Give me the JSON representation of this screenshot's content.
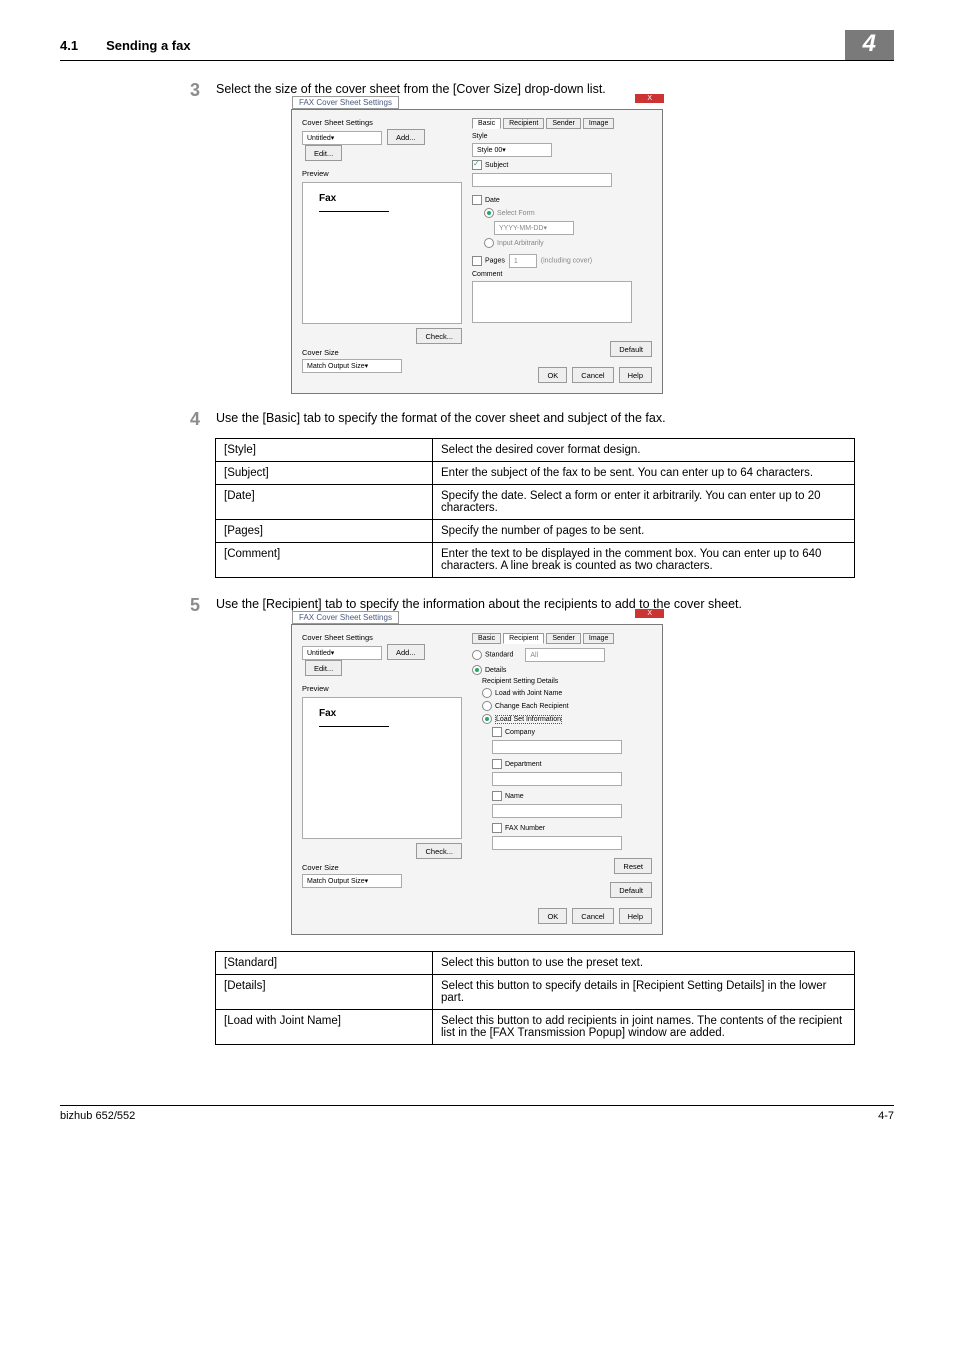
{
  "header": {
    "sec": "4.1",
    "title": "Sending a fax",
    "chapter": "4"
  },
  "steps": {
    "s3": {
      "num": "3",
      "txt": "Select the size of the cover sheet from the [Cover Size] drop-down list."
    },
    "s4": {
      "num": "4",
      "txt": "Use the [Basic] tab to specify the format of the cover sheet and subject of the fax."
    },
    "s5": {
      "num": "5",
      "txt": "Use the [Recipient] tab to specify the information about the recipients to add to the cover sheet."
    }
  },
  "dlg": {
    "title": "FAX Cover Sheet Settings",
    "coverSheetSettings": "Cover Sheet Settings",
    "untitled": "Untitled",
    "add": "Add...",
    "edit": "Edit...",
    "preview": "Preview",
    "fax": "Fax",
    "check": "Check...",
    "coverSize": "Cover Size",
    "match": "Match Output Size",
    "ok": "OK",
    "cancel": "Cancel",
    "help": "Help",
    "default": "Default",
    "tabs": {
      "basic": "Basic",
      "recipient": "Recipient",
      "sender": "Sender",
      "image": "Image"
    },
    "basic": {
      "style": "Style",
      "styleSel": "Style 00",
      "subject": "Subject",
      "date": "Date",
      "selectForm": "Select Form",
      "dateFmt": "YYYY-MM-DD",
      "inputArb": "Input Arbitrarily",
      "pages": "Pages",
      "pagesVal": "1",
      "inclCover": "(including cover)",
      "comment": "Comment"
    },
    "recipient": {
      "standard": "Standard",
      "all": "All",
      "details": "Details",
      "rsd": "Recipient Setting Details",
      "loadJoint": "Load with Joint Name",
      "changeEach": "Change Each Recipient",
      "loadSet": "Load Set Information",
      "company": "Company",
      "department": "Department",
      "name": "Name",
      "faxnum": "FAX Number",
      "reset": "Reset"
    }
  },
  "table4": [
    {
      "k": "[Style]",
      "v": "Select the desired cover format design."
    },
    {
      "k": "[Subject]",
      "v": "Enter the subject of the fax to be sent. You can enter up to 64 characters."
    },
    {
      "k": "[Date]",
      "v": "Specify the date. Select a form or enter it arbitrarily. You can enter up to 20 characters."
    },
    {
      "k": "[Pages]",
      "v": "Specify the number of pages to be sent."
    },
    {
      "k": "[Comment]",
      "v": "Enter the text to be displayed in the comment box. You can enter up to 640 characters. A line break is counted as two characters."
    }
  ],
  "table5": [
    {
      "k": "[Standard]",
      "v": "Select this button to use the preset text."
    },
    {
      "k": "[Details]",
      "v": "Select this button to specify details in [Recipient Setting Details] in the lower part."
    },
    {
      "k": "[Load with Joint Name]",
      "v": "Select this button to add recipients in joint names. The contents of the recipient list in the [FAX Transmission Popup] window are added."
    }
  ],
  "footer": {
    "left": "bizhub 652/552",
    "right": "4-7"
  }
}
